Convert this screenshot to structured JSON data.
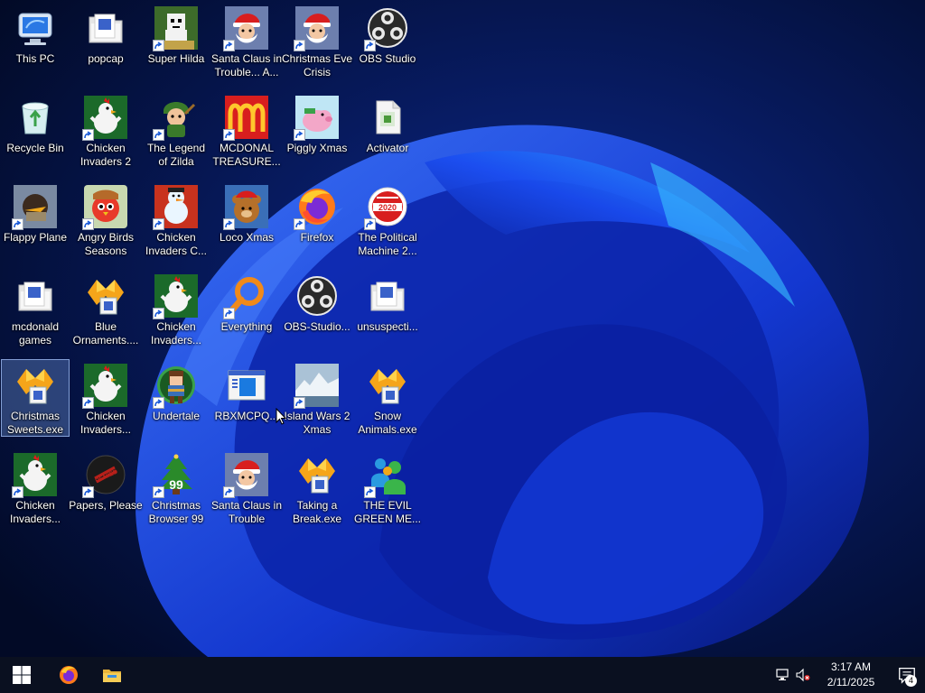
{
  "desktop": {
    "icons": [
      {
        "label": "This PC",
        "icon": "computer-icon",
        "shortcut": false
      },
      {
        "label": "popcap",
        "icon": "folder-icon",
        "shortcut": false
      },
      {
        "label": "Super Hilda",
        "icon": "pixel-character-icon",
        "shortcut": true
      },
      {
        "label": "Santa Claus in\nTrouble... A...",
        "icon": "santa-icon",
        "shortcut": true
      },
      {
        "label": "Christmas Eve\nCrisis",
        "icon": "santa-icon",
        "shortcut": true
      },
      {
        "label": "OBS Studio",
        "icon": "obs-icon",
        "shortcut": true
      },
      {
        "label": "Recycle Bin",
        "icon": "recycle-bin-icon",
        "shortcut": false
      },
      {
        "label": "Chicken\nInvaders 2",
        "icon": "chicken-icon",
        "shortcut": true
      },
      {
        "label": "The Legend\nof Zilda",
        "icon": "hero-character-icon",
        "shortcut": true
      },
      {
        "label": "MCDONAL\nTREASURE...",
        "icon": "mcdonalds-icon",
        "shortcut": true
      },
      {
        "label": "Piggly Xmas",
        "icon": "pig-icon",
        "shortcut": true
      },
      {
        "label": "Activator",
        "icon": "file-icon",
        "shortcut": false
      },
      {
        "label": "Flappy Plane",
        "icon": "plane-icon",
        "shortcut": true
      },
      {
        "label": "Angry Birds\nSeasons",
        "icon": "angry-birds-icon",
        "shortcut": true
      },
      {
        "label": "Chicken\nInvaders C...",
        "icon": "snowman-icon",
        "shortcut": true
      },
      {
        "label": "Loco Xmas",
        "icon": "bear-icon",
        "shortcut": true
      },
      {
        "label": "Firefox",
        "icon": "firefox-icon",
        "shortcut": true
      },
      {
        "label": "The Political\nMachine 2...",
        "icon": "election-badge-icon",
        "shortcut": true
      },
      {
        "label": "mcdonald\ngames",
        "icon": "folder-icon",
        "shortcut": false
      },
      {
        "label": "Blue\nOrnaments....",
        "icon": "installer-icon",
        "shortcut": false
      },
      {
        "label": "Chicken\nInvaders...",
        "icon": "chicken-icon",
        "shortcut": true
      },
      {
        "label": "Everything",
        "icon": "search-icon",
        "shortcut": true
      },
      {
        "label": "OBS-Studio...",
        "icon": "obs-icon",
        "shortcut": false
      },
      {
        "label": "unsuspecti...",
        "icon": "folder-icon",
        "shortcut": false
      },
      {
        "label": "Christmas\nSweets.exe",
        "icon": "installer-icon",
        "shortcut": false,
        "selected": true
      },
      {
        "label": "Chicken\nInvaders...",
        "icon": "chicken-icon",
        "shortcut": true
      },
      {
        "label": "Undertale",
        "icon": "undertale-icon",
        "shortcut": true
      },
      {
        "label": "RBXMCPQ...",
        "icon": "window-icon",
        "shortcut": false
      },
      {
        "label": "Island Wars 2\nXmas",
        "icon": "island-icon",
        "shortcut": true
      },
      {
        "label": "Snow\nAnimals.exe",
        "icon": "installer-icon",
        "shortcut": false
      },
      {
        "label": "Chicken\nInvaders...",
        "icon": "chicken-icon",
        "shortcut": true
      },
      {
        "label": "Papers, Please",
        "icon": "papers-please-icon",
        "shortcut": true
      },
      {
        "label": "Christmas\nBrowser 99",
        "icon": "christmas-tree-icon",
        "shortcut": true
      },
      {
        "label": "Santa Claus in\nTrouble",
        "icon": "santa-icon",
        "shortcut": true
      },
      {
        "label": "Taking a\nBreak.exe",
        "icon": "installer-icon",
        "shortcut": false
      },
      {
        "label": "THE EVIL\nGREEN ME...",
        "icon": "messenger-icon",
        "shortcut": true
      }
    ]
  },
  "taskbar": {
    "start": "windows-logo-icon",
    "pinned": [
      "firefox-icon",
      "file-explorer-icon"
    ],
    "tray_icons": [
      "network-icon",
      "volume-muted-icon"
    ],
    "clock": {
      "time": "3:17 AM",
      "date": "2/11/2025"
    },
    "notifications": {
      "icon": "action-center-icon",
      "count": "4"
    }
  },
  "colors": {
    "taskbar": "#0a1020",
    "wallpaper_dark": "#020b2e",
    "wallpaper_bloom": "#1236d8",
    "selection": "#6f9ce6"
  }
}
